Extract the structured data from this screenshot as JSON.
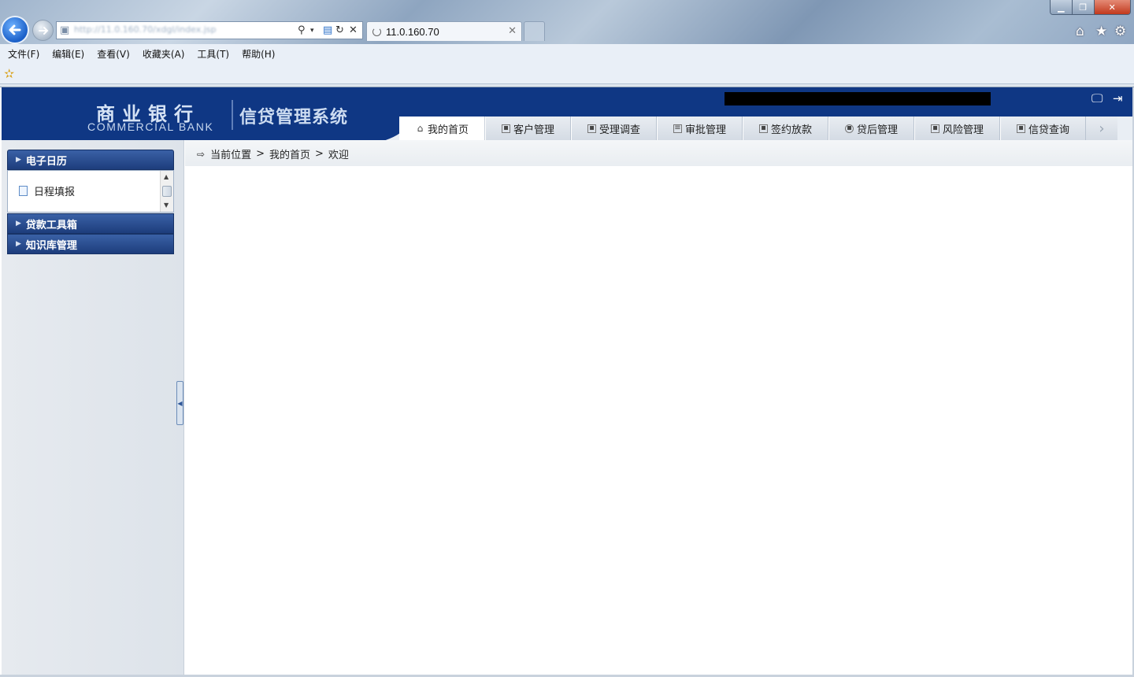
{
  "browser": {
    "address_url": "http://11.0.160.70/xdgl/index.jsp",
    "tab_title": "11.0.160.70",
    "menu": [
      "文件(F)",
      "编辑(E)",
      "查看(V)",
      "收藏夹(A)",
      "工具(T)",
      "帮助(H)"
    ]
  },
  "header": {
    "bank_cn": "商业银行",
    "bank_en": "COMMERCIAL BANK",
    "system_title": "信贷管理系统"
  },
  "nav": {
    "tabs": [
      "我的首页",
      "客户管理",
      "受理调查",
      "审批管理",
      "签约放款",
      "贷后管理",
      "风险管理",
      "信贷查询"
    ],
    "active_index": 0
  },
  "sidebar": {
    "sections": [
      {
        "title": "电子日历",
        "expanded": true,
        "items": [
          "日程填报"
        ]
      },
      {
        "title": "贷款工具箱",
        "expanded": false
      },
      {
        "title": "知识库管理",
        "expanded": false
      }
    ]
  },
  "breadcrumb": {
    "label": "当前位置",
    "path": [
      "我的首页",
      "欢迎"
    ],
    "separator": ">"
  },
  "colors": {
    "header_blue": "#0f3784",
    "sidebar_header": "#2b4f93"
  }
}
